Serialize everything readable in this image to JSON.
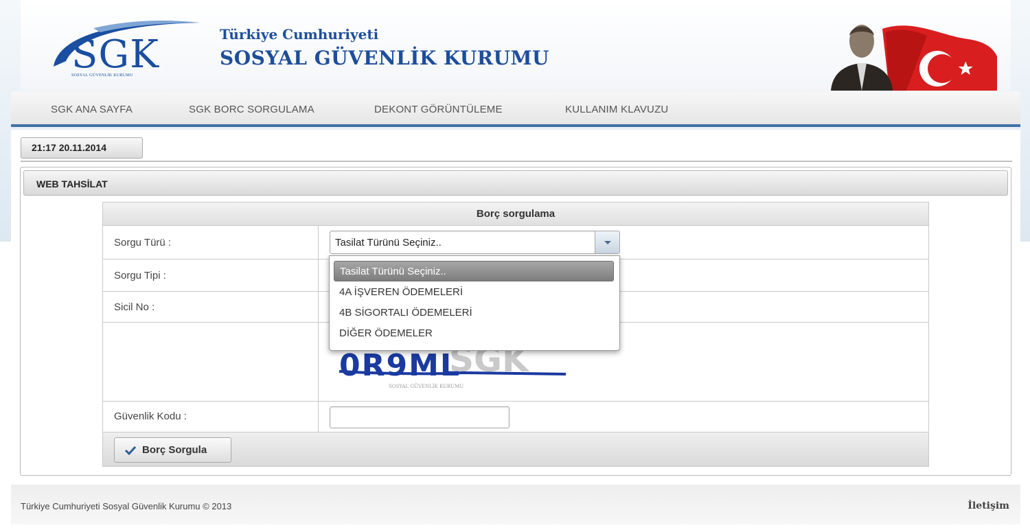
{
  "header": {
    "logo_text": "SGK",
    "logo_subtitle": "SOSYAL GÜVENLİK KURUMU",
    "org_line1": "Türkiye Cumhuriyeti",
    "org_line2": "SOSYAL GÜVENLİK KURUMU"
  },
  "nav": {
    "items": [
      {
        "label": "SGK ANA SAYFA"
      },
      {
        "label": "SGK BORC SORGULAMA"
      },
      {
        "label": "DEKONT GÖRÜNTÜLEME"
      },
      {
        "label": "KULLANIM KLAVUZU"
      }
    ]
  },
  "clock": "21:17 20.11.2014",
  "panel": {
    "title": "WEB TAHSİLAT"
  },
  "form": {
    "title": "Borç sorgulama",
    "labels": {
      "sorgu_turu": "Sorgu Türü :",
      "sorgu_tipi": "Sorgu Tipi :",
      "sicil_no": "Sicil No :",
      "guvenlik_kodu": "Güvenlik Kodu :"
    },
    "select": {
      "selected": "Tasilat Türünü Seçiniz..",
      "options": [
        "Tasilat Türünü Seçiniz..",
        "4A İŞVEREN ÖDEMELERİ",
        "4B SİGORTALI ÖDEMELERİ",
        "DİĞER ÖDEMELER"
      ]
    },
    "captcha_text": "0R9ML",
    "captcha_watermark": "SOSYAL GÜVENLİK KURUMU",
    "security_input_value": "",
    "submit_label": "Borç Sorgula"
  },
  "footer": {
    "copyright": "Türkiye Cumhuriyeti Sosyal Güvenlik Kurumu © 2013",
    "contact": "İletişim"
  },
  "colors": {
    "brand_blue": "#1d4e9a",
    "nav_border": "#3f72a8"
  }
}
